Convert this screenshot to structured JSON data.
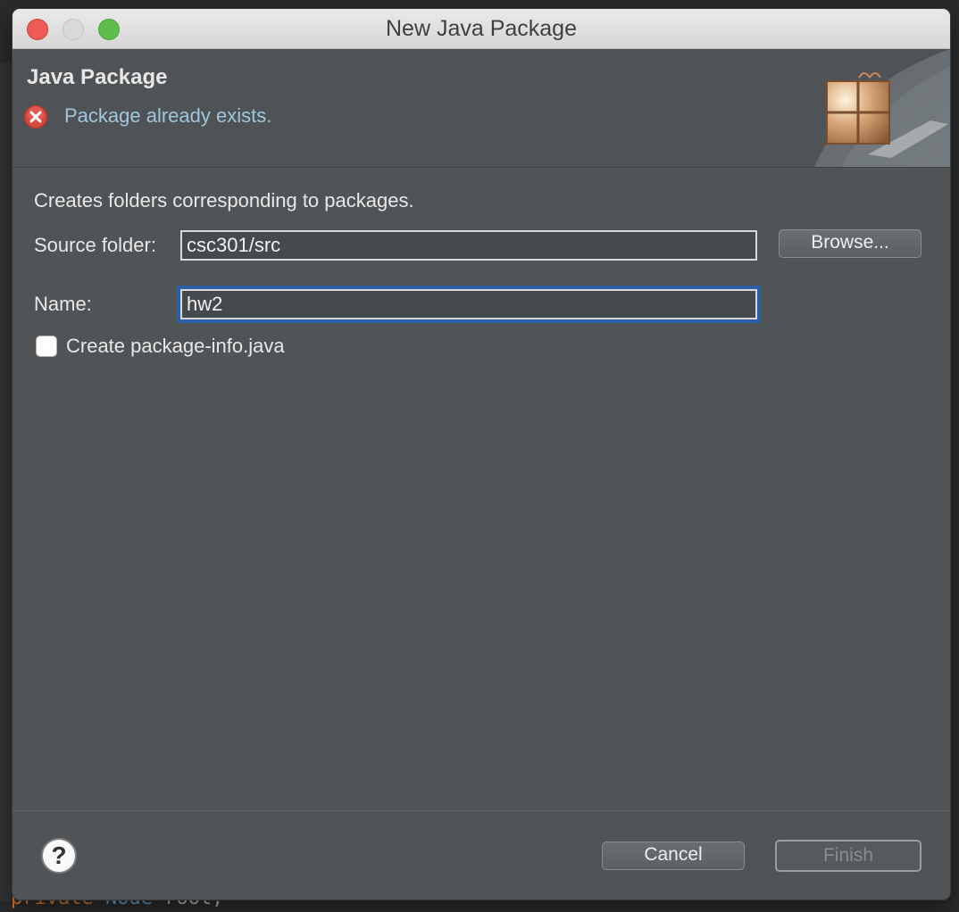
{
  "background_code": {
    "keyword": "private",
    "type": "Node",
    "variable": "root;"
  },
  "window": {
    "title": "New Java Package"
  },
  "header": {
    "title": "Java Package",
    "error_icon": "error-x-icon",
    "error_message": "Package already exists.",
    "banner_icon": "package-icon"
  },
  "form": {
    "description": "Creates folders corresponding to packages.",
    "source_folder_label": "Source folder:",
    "source_folder_value": "csc301/src",
    "browse_label": "Browse...",
    "name_label": "Name:",
    "name_value": "hw2",
    "package_info_label": "Create package-info.java",
    "package_info_checked": false
  },
  "footer": {
    "help_icon": "?",
    "cancel_label": "Cancel",
    "finish_label": "Finish"
  },
  "colors": {
    "dialog_bg": "#505457",
    "error_text": "#9fc7dc",
    "focus_ring": "#2d5fa4"
  }
}
